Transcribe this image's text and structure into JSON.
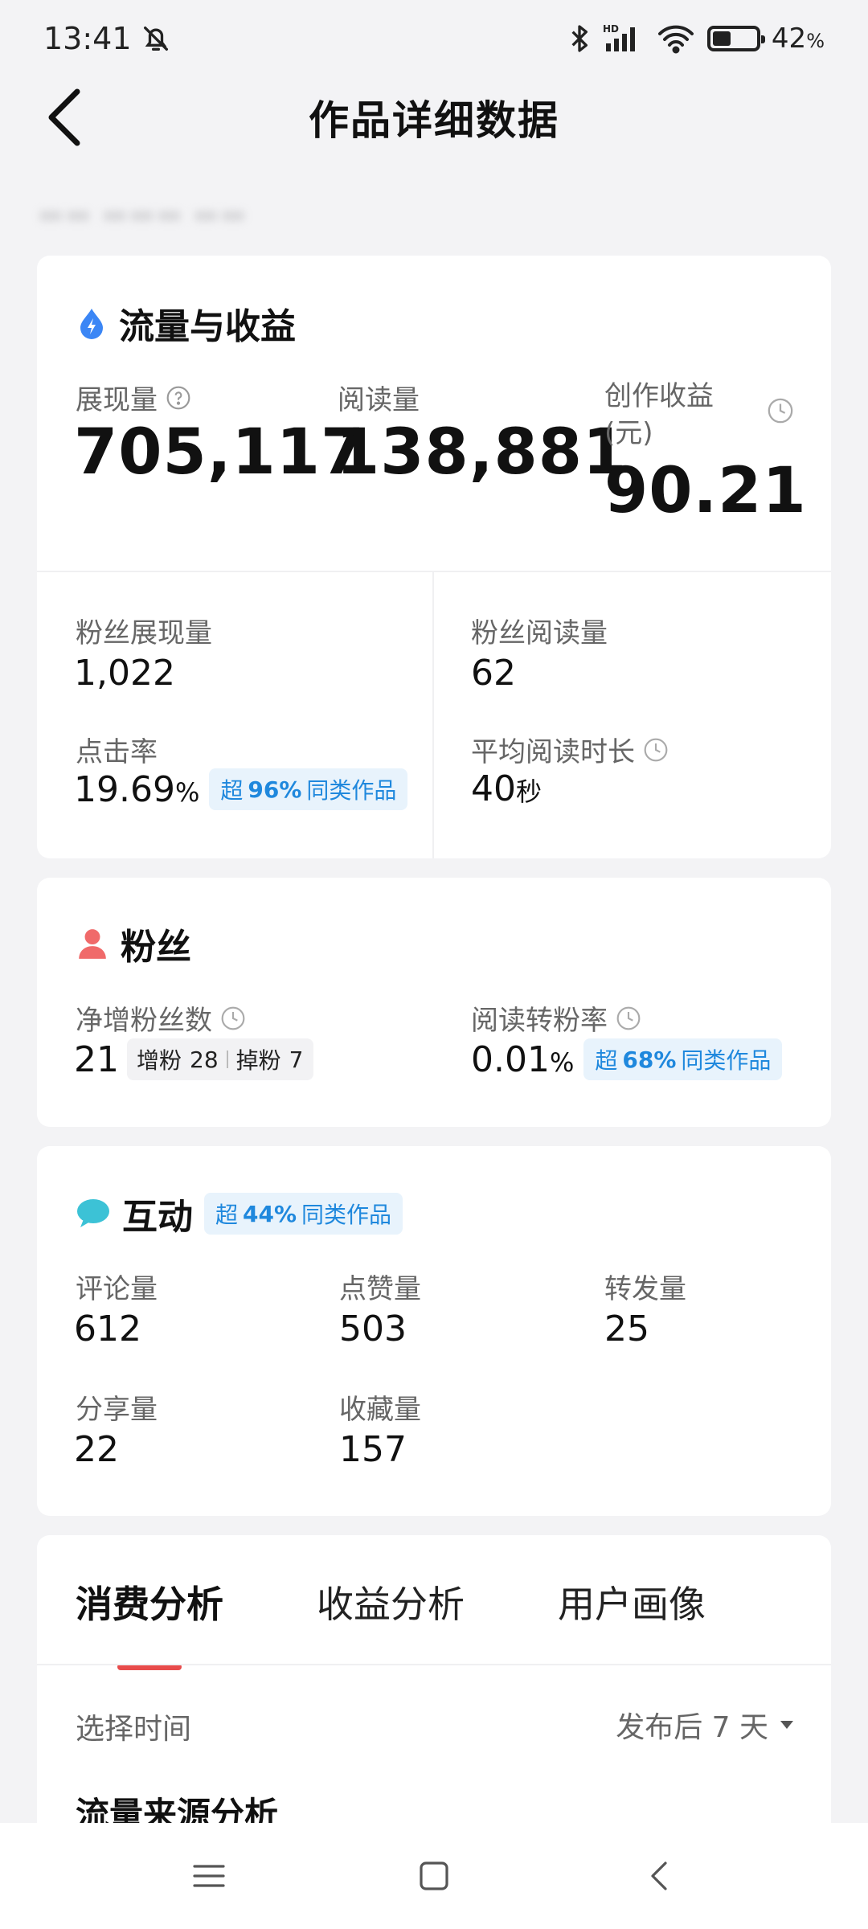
{
  "status_bar": {
    "time": "13:41",
    "battery_level": 0.42,
    "battery_pct": "42",
    "battery_pct_sign": "%",
    "hd_label": "HD"
  },
  "header": {
    "title": "作品详细数据"
  },
  "traffic": {
    "title": "流量与收益",
    "impressions_label": "展现量",
    "impressions_value": "705,117",
    "reads_label": "阅读量",
    "reads_value": "138,881",
    "earnings_label_1": "创作收益",
    "earnings_label_2": "(元)",
    "earnings_value": "90.21",
    "fan_impressions_label": "粉丝展现量",
    "fan_impressions_value": "1,022",
    "fan_reads_label": "粉丝阅读量",
    "fan_reads_value": "62",
    "ctr_label": "点击率",
    "ctr_value": "19.69",
    "ctr_unit": "%",
    "ctr_badge_prefix": "超",
    "ctr_badge_pct": "96%",
    "ctr_badge_suffix": "同类作品",
    "avg_time_label": "平均阅读时长",
    "avg_time_value": "40",
    "avg_time_unit": "秒"
  },
  "fans": {
    "title": "粉丝",
    "net_label": "净增粉丝数",
    "net_value": "21",
    "gain_label": "增粉",
    "gain_value": "28",
    "loss_label": "掉粉",
    "loss_value": "7",
    "conv_label": "阅读转粉率",
    "conv_value": "0.01",
    "conv_unit": "%",
    "conv_badge_prefix": "超",
    "conv_badge_pct": "68%",
    "conv_badge_suffix": "同类作品"
  },
  "interaction": {
    "title": "互动",
    "badge_prefix": "超",
    "badge_pct": "44%",
    "badge_suffix": "同类作品",
    "comments_label": "评论量",
    "comments_value": "612",
    "likes_label": "点赞量",
    "likes_value": "503",
    "reposts_label": "转发量",
    "reposts_value": "25",
    "shares_label": "分享量",
    "shares_value": "22",
    "favorites_label": "收藏量",
    "favorites_value": "157"
  },
  "analysis": {
    "tabs": [
      "消费分析",
      "收益分析",
      "用户画像"
    ],
    "active_tab": 0,
    "time_label": "选择时间",
    "time_value": "发布后 7 天",
    "section_title": "流量来源分析"
  },
  "colors": {
    "accent_blue": "#1f88dd",
    "badge_bg": "#e8f3fc",
    "tab_underline": "#e84b4b",
    "fan_icon": "#f06a6a",
    "chat_icon": "#3cc2d6",
    "bolt_icon": "#3b86f5"
  }
}
